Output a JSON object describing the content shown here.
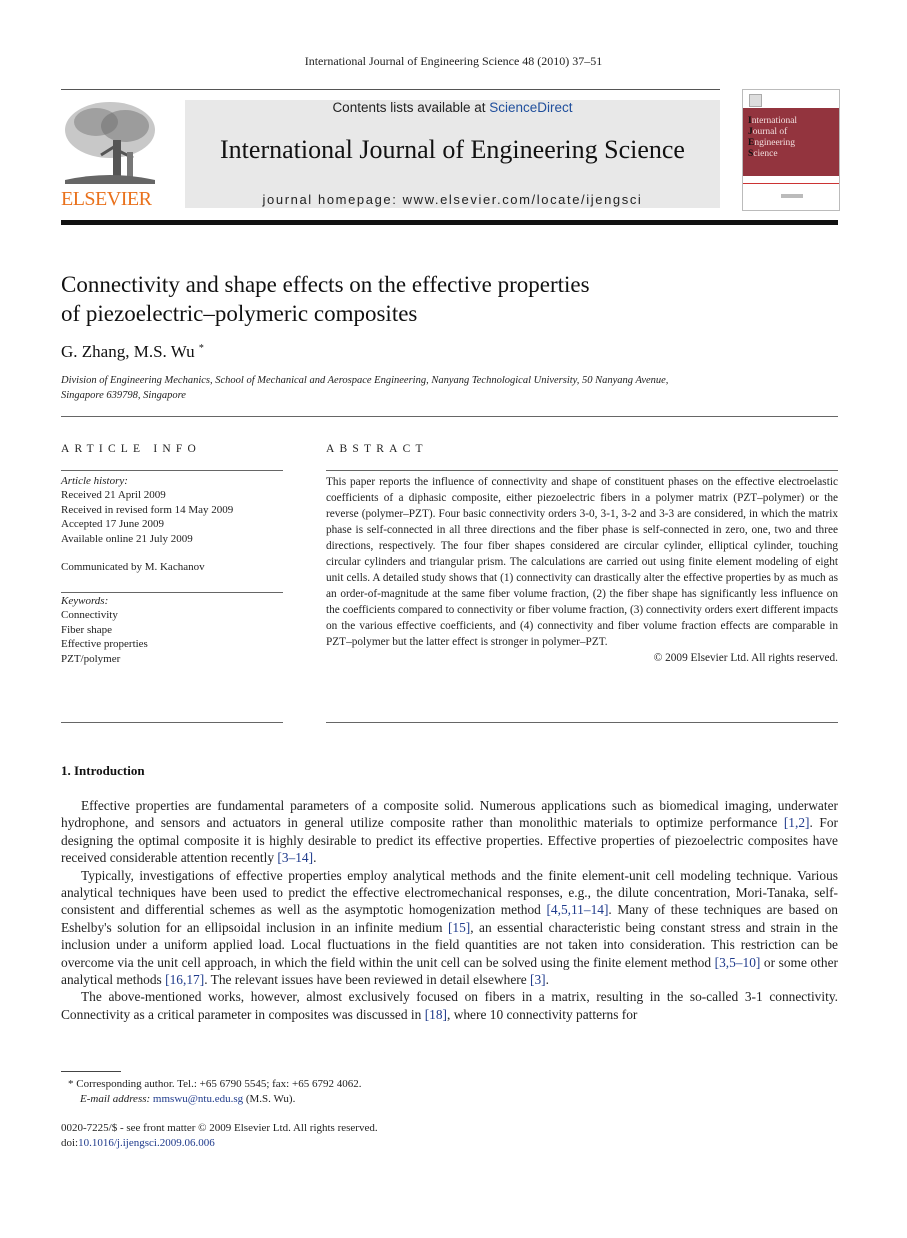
{
  "running_head": "International Journal of Engineering Science 48 (2010) 37–51",
  "header": {
    "publisher": "ELSEVIER",
    "contents_prefix": "Contents lists available at ",
    "contents_link": "ScienceDirect",
    "journal_title": "International Journal of Engineering Science",
    "homepage": "journal homepage: www.elsevier.com/locate/ijengsci",
    "cover": {
      "line1_initial": "I",
      "line1_rest": "nternational",
      "line2_initial": "J",
      "line2_rest": "ournal of",
      "line3_initial": "E",
      "line3_rest": "ngineering",
      "line4_initial": "S",
      "line4_rest": "cience",
      "band_color": "#93343e"
    },
    "brand_color": "#e9711c",
    "link_color": "#1f3b8c"
  },
  "article": {
    "title_line1": "Connectivity and shape effects on the effective properties",
    "title_line2": "of piezoelectric–polymeric composites",
    "authors": "G. Zhang, M.S. Wu",
    "author_mark": "*",
    "affiliation_line1": "Division of Engineering Mechanics, School of Mechanical and Aerospace Engineering, Nanyang Technological University, 50 Nanyang Avenue,",
    "affiliation_line2": "Singapore 639798, Singapore"
  },
  "article_info": {
    "heading": "ARTICLE INFO",
    "history_label": "Article history:",
    "history": [
      "Received 21 April 2009",
      "Received in revised form 14 May 2009",
      "Accepted 17 June 2009",
      "Available online 21 July 2009"
    ],
    "communicated": "Communicated by M. Kachanov",
    "keywords_label": "Keywords:",
    "keywords": [
      "Connectivity",
      "Fiber shape",
      "Effective properties",
      "PZT/polymer"
    ]
  },
  "abstract": {
    "heading": "ABSTRACT",
    "text": "This paper reports the influence of connectivity and shape of constituent phases on the effective electroelastic coefficients of a diphasic composite, either piezoelectric fibers in a polymer matrix (PZT–polymer) or the reverse (polymer–PZT). Four basic connectivity orders 3-0, 3-1, 3-2 and 3-3 are considered, in which the matrix phase is self-connected in all three directions and the fiber phase is self-connected in zero, one, two and three directions, respectively. The four fiber shapes considered are circular cylinder, elliptical cylinder, touching circular cylinders and triangular prism. The calculations are carried out using finite element modeling of eight unit cells. A detailed study shows that (1) connectivity can drastically alter the effective properties by as much as an order-of-magnitude at the same fiber volume fraction, (2) the fiber shape has significantly less influence on the coefficients compared to connectivity or fiber volume fraction, (3) connectivity orders exert different impacts on the various effective coefficients, and (4) connectivity and fiber volume fraction effects are comparable in PZT–polymer but the latter effect is stronger in polymer–PZT.",
    "copyright": "© 2009 Elsevier Ltd. All rights reserved."
  },
  "introduction": {
    "heading": "1.  Introduction",
    "p1": [
      "Effective properties are fundamental parameters of a composite solid. Numerous applications such as biomedical imaging, underwater hydrophone, and sensors and actuators in general utilize composite rather than monolithic materials to optimize performance ",
      "[1,2]",
      ". For designing the optimal composite it is highly desirable to predict its effective properties. Effective properties of piezoelectric composites have received considerable attention recently ",
      "[3–14]",
      "."
    ],
    "p2": [
      "Typically, investigations of effective properties employ analytical methods and the finite element-unit cell modeling technique. Various analytical techniques have been used to predict the effective electromechanical responses, e.g., the dilute concentration, Mori-Tanaka, self-consistent and differential schemes as well as the asymptotic homogenization method ",
      "[4,5,11–14]",
      ". Many of these techniques are based on Eshelby's solution for an ellipsoidal inclusion in an infinite medium ",
      "[15]",
      ", an essential characteristic being constant stress and strain in the inclusion under a uniform applied load. Local fluctuations in the field quantities are not taken into consideration. This restriction can be overcome via the unit cell approach, in which the field within the unit cell can be solved using the finite element method ",
      "[3,5–10]",
      " or some other analytical methods ",
      "[16,17]",
      ". The relevant issues have been reviewed in detail elsewhere ",
      "[3]",
      "."
    ],
    "p3": [
      "The above-mentioned works, however, almost exclusively focused on fibers in a matrix, resulting in the so-called 3-1 connectivity. Connectivity as a critical parameter in composites was discussed in ",
      "[18]",
      ", where 10 connectivity patterns for"
    ]
  },
  "footnote": {
    "mark": "*",
    "corresponding": " Corresponding author. Tel.: +65 6790 5545; fax: +65 6792 4062.",
    "email_label": "E-mail address:",
    "email": "mmswu@ntu.edu.sg",
    "email_suffix": " (M.S. Wu)."
  },
  "issn": {
    "line": "0020-7225/$ - see front matter © 2009 Elsevier Ltd. All rights reserved.",
    "doi_label": "doi:",
    "doi": "10.1016/j.ijengsci.2009.06.006"
  }
}
